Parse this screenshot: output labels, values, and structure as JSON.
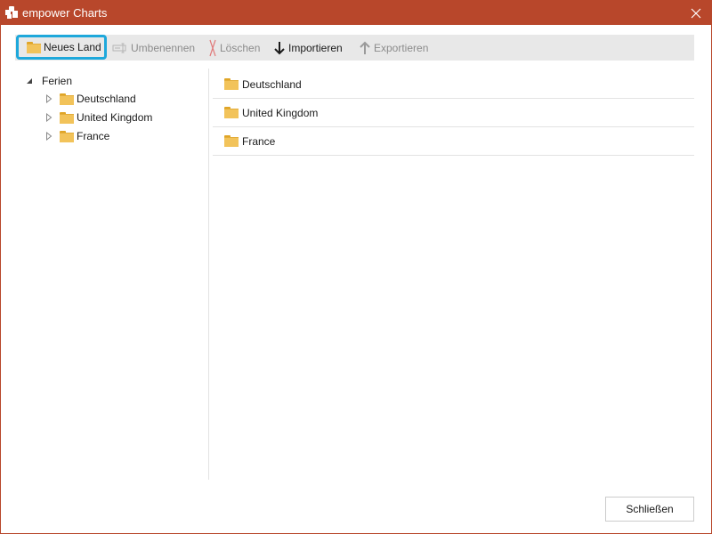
{
  "window": {
    "title": "empower Charts",
    "accent_color": "#b8472b",
    "close_icon": "close-icon",
    "logo_icon": "empower-logo-icon"
  },
  "toolbar": {
    "new_country": {
      "label": "Neues Land",
      "icon": "folder-icon",
      "focused": true,
      "focus_color": "#1ea8db"
    },
    "rename": {
      "label": "Umbenennen",
      "icon": "rename-icon",
      "disabled": true
    },
    "delete": {
      "label": "Löschen",
      "icon": "delete-x-icon",
      "disabled": true
    },
    "import": {
      "label": "Importieren",
      "icon": "arrow-down-icon",
      "disabled": false
    },
    "export": {
      "label": "Exportieren",
      "icon": "arrow-up-icon",
      "disabled": true
    }
  },
  "tree": {
    "root": {
      "label": "Ferien",
      "expanded": true
    },
    "items": [
      {
        "label": "Deutschland"
      },
      {
        "label": "United Kingdom"
      },
      {
        "label": "France"
      }
    ]
  },
  "list": {
    "items": [
      {
        "label": "Deutschland"
      },
      {
        "label": "United Kingdom"
      },
      {
        "label": "France"
      }
    ]
  },
  "footer": {
    "close_label": "Schließen"
  }
}
